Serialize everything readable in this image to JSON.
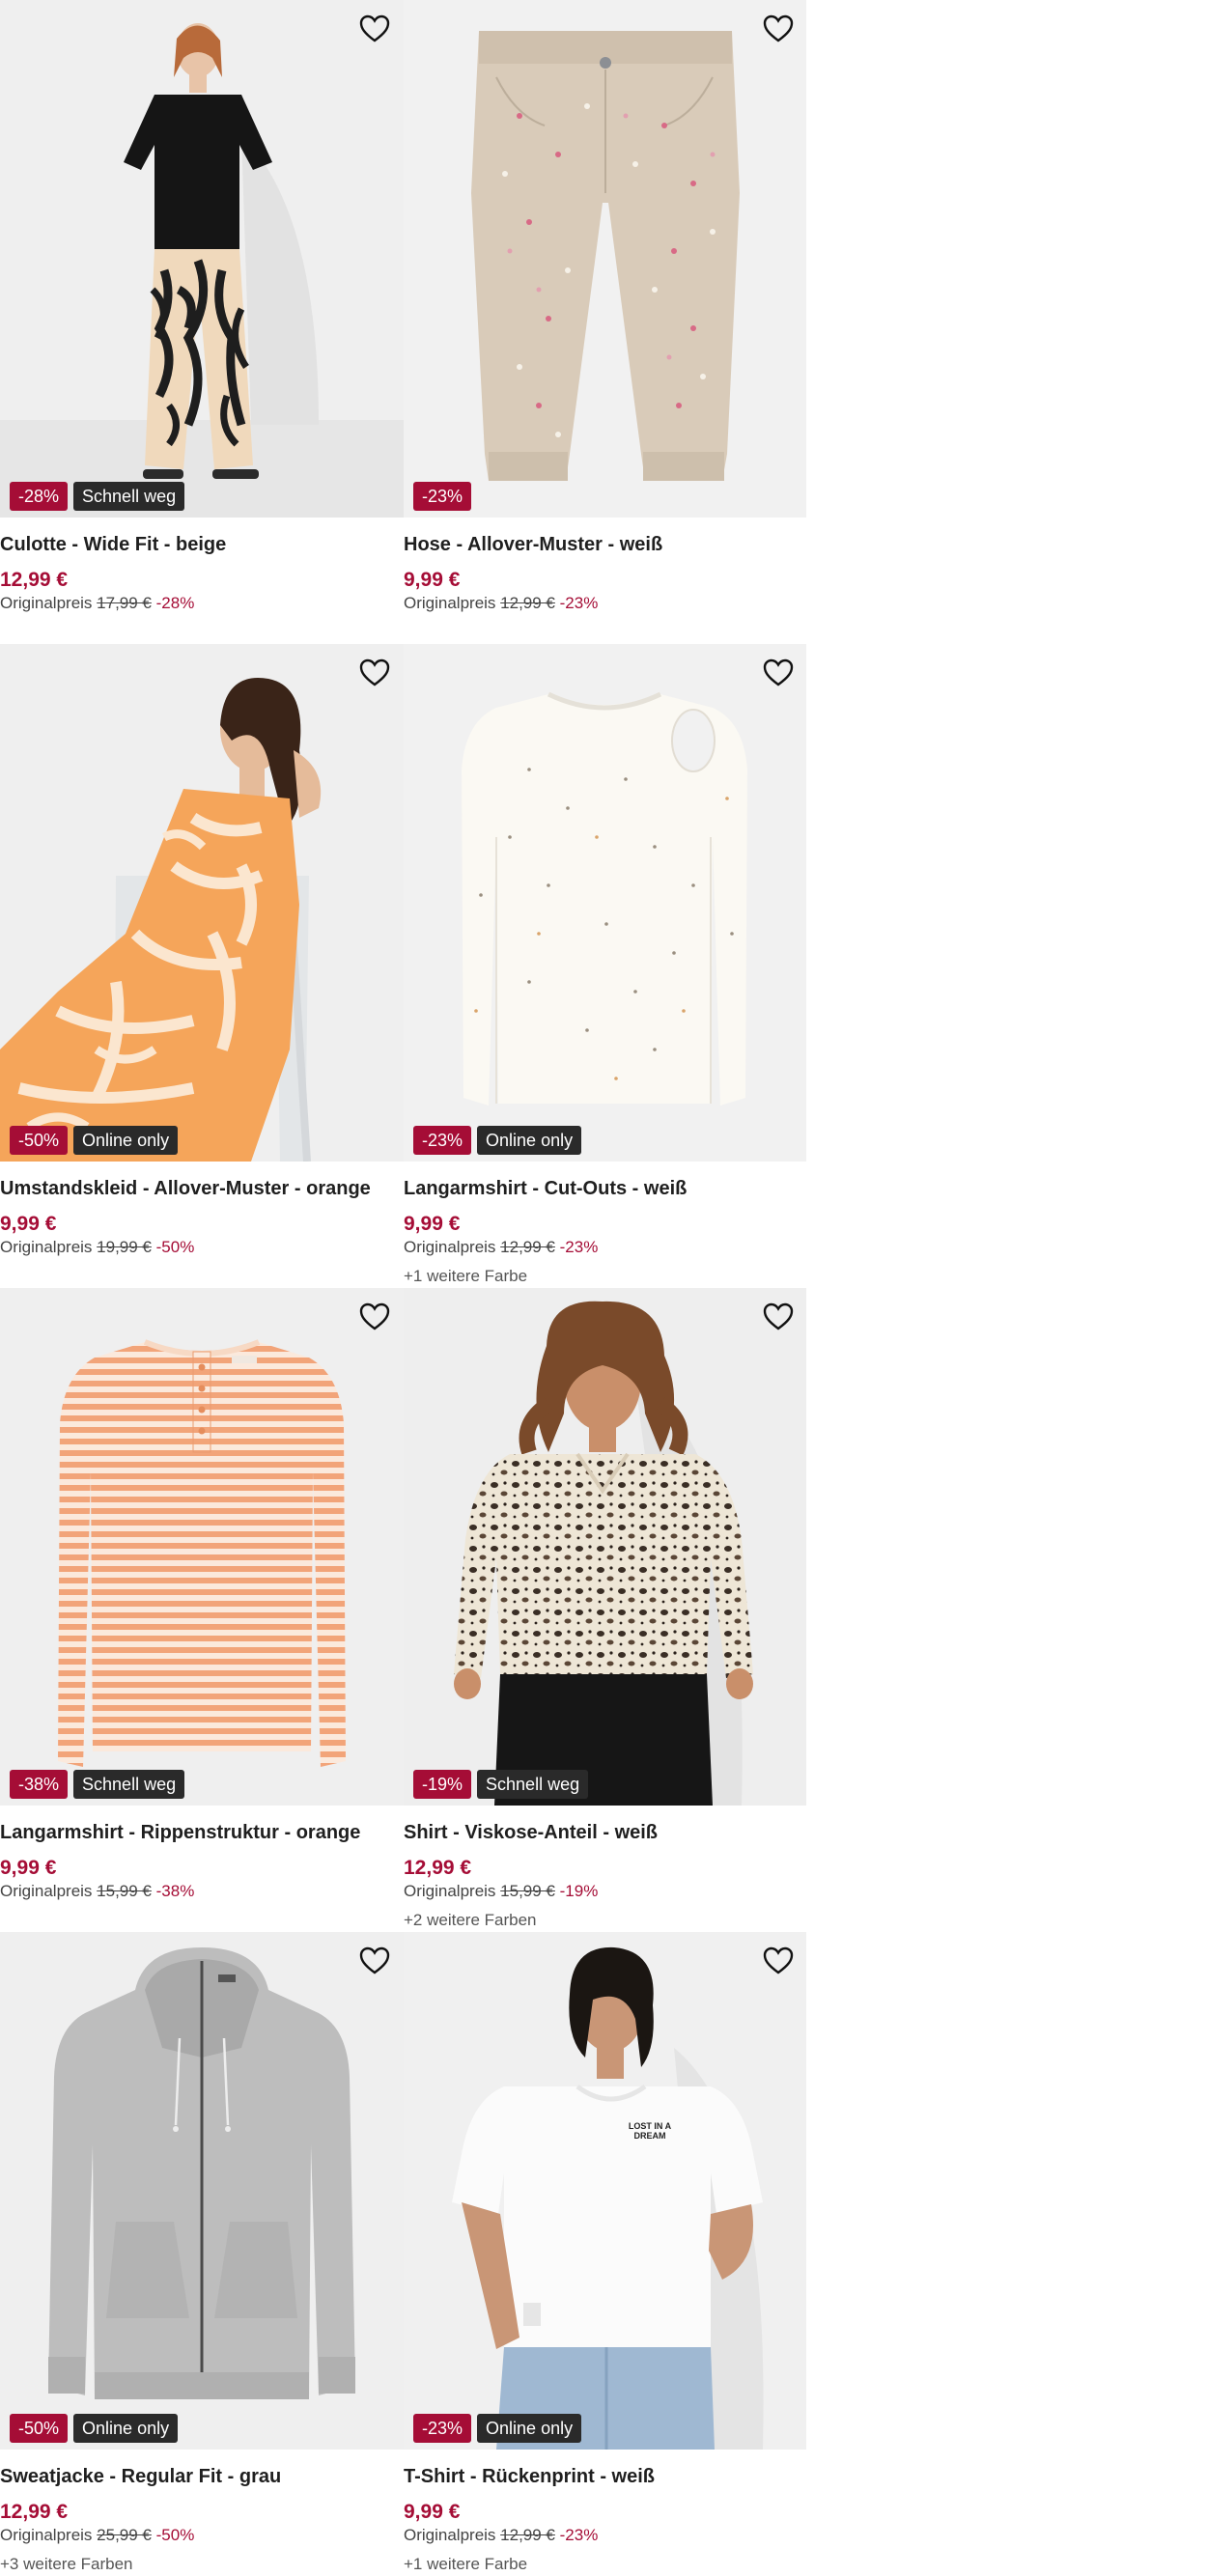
{
  "products": [
    {
      "title": "Culotte - Wide Fit - beige",
      "price": "12,99 €",
      "original_label": "Originalpreis",
      "original_price": "17,99 €",
      "discount_text": "-28%",
      "badge_discount": "-28%",
      "badge_tag": "Schnell weg",
      "more_colors": "",
      "image": "woman-black-top-patterned-culotte",
      "wishlist_icon": "heart-outline-icon"
    },
    {
      "title": "Hose - Allover-Muster - weiß",
      "price": "9,99 €",
      "original_label": "Originalpreis",
      "original_price": "12,99 €",
      "discount_text": "-23%",
      "badge_discount": "-23%",
      "badge_tag": "",
      "more_colors": "",
      "image": "beige-kids-trousers-dotted",
      "wishlist_icon": "heart-outline-icon"
    },
    {
      "title": "Umstandskleid - Allover-Muster - orange",
      "price": "9,99 €",
      "original_label": "Originalpreis",
      "original_price": "19,99 €",
      "discount_text": "-50%",
      "badge_discount": "-50%",
      "badge_tag": "Online only",
      "more_colors": "",
      "image": "woman-orange-pattern-dress-seated",
      "wishlist_icon": "heart-outline-icon"
    },
    {
      "title": "Langarmshirt - Cut-Outs - weiß",
      "price": "9,99 €",
      "original_label": "Originalpreis",
      "original_price": "12,99 €",
      "discount_text": "-23%",
      "badge_discount": "-23%",
      "badge_tag": "Online only",
      "more_colors": "+1 weitere Farbe",
      "image": "white-speckled-longsleeve",
      "wishlist_icon": "heart-outline-icon"
    },
    {
      "title": "Langarmshirt - Rippenstruktur - orange",
      "price": "9,99 €",
      "original_label": "Originalpreis",
      "original_price": "15,99 €",
      "discount_text": "-38%",
      "badge_discount": "-38%",
      "badge_tag": "Schnell weg",
      "more_colors": "",
      "image": "orange-striped-longsleeve",
      "wishlist_icon": "heart-outline-icon"
    },
    {
      "title": "Shirt - Viskose-Anteil - weiß",
      "price": "12,99 €",
      "original_label": "Originalpreis",
      "original_price": "15,99 €",
      "discount_text": "-19%",
      "badge_discount": "-19%",
      "badge_tag": "Schnell weg",
      "more_colors": "+2 weitere Farben",
      "image": "woman-leopard-print-blouse",
      "wishlist_icon": "heart-outline-icon"
    },
    {
      "title": "Sweatjacke - Regular Fit - grau",
      "price": "12,99 €",
      "original_label": "Originalpreis",
      "original_price": "25,99 €",
      "discount_text": "-50%",
      "badge_discount": "-50%",
      "badge_tag": "Online only",
      "more_colors": "+3 weitere Farben",
      "image": "grey-zip-hoodie",
      "wishlist_icon": "heart-outline-icon"
    },
    {
      "title": "T-Shirt - Rückenprint - weiß",
      "price": "9,99 €",
      "original_label": "Originalpreis",
      "original_price": "12,99 €",
      "discount_text": "-23%",
      "badge_discount": "-23%",
      "badge_tag": "Online only",
      "more_colors": "+1 weitere Farbe",
      "image": "woman-white-tshirt-jeans",
      "wishlist_icon": "heart-outline-icon",
      "print_text": "LOST IN A DREAM"
    }
  ],
  "colors": {
    "sale_red": "#a50d36",
    "tag_dark": "#2a2a2a",
    "image_bg": "#f0f0f0"
  }
}
